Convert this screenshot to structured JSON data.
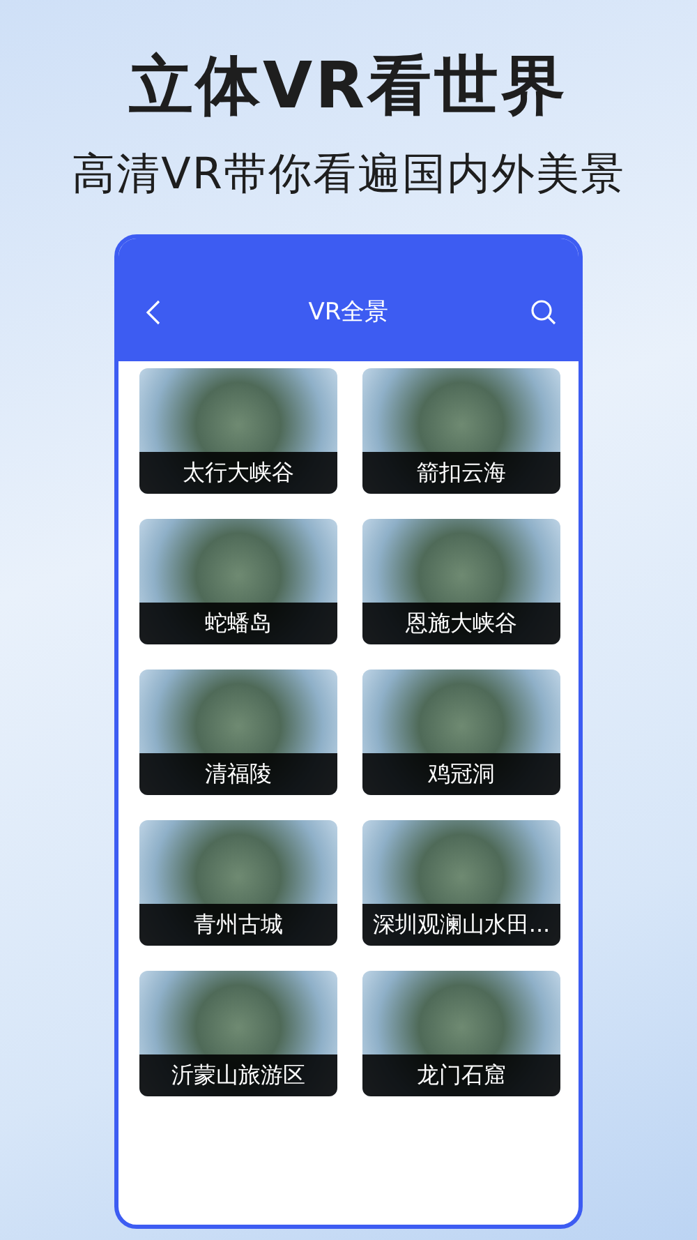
{
  "headline": "立体VR看世界",
  "subheadline": "高清VR带你看遍国内外美景",
  "app": {
    "title": "VR全景",
    "places": [
      {
        "name": "太行大峡谷"
      },
      {
        "name": "箭扣云海"
      },
      {
        "name": "蛇蟠岛"
      },
      {
        "name": "恩施大峡谷"
      },
      {
        "name": "清福陵"
      },
      {
        "name": "鸡冠洞"
      },
      {
        "name": "青州古城"
      },
      {
        "name": "深圳观澜山水田..."
      },
      {
        "name": "沂蒙山旅游区"
      },
      {
        "name": "龙门石窟"
      }
    ]
  }
}
